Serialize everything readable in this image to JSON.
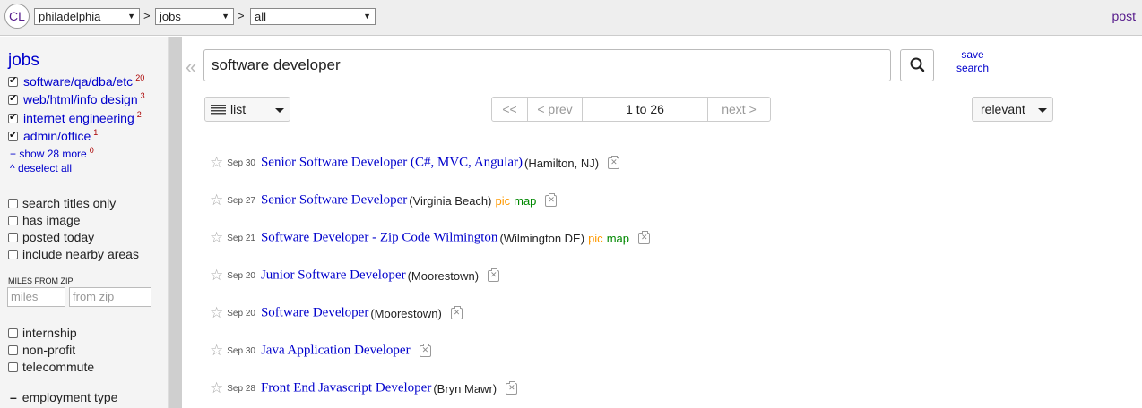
{
  "topbar": {
    "logo": "CL",
    "area": "philadelphia",
    "category": "jobs",
    "subcategory": "all",
    "separator": ">",
    "post_label": "post"
  },
  "sidebar": {
    "category_title": "jobs",
    "categories": [
      {
        "label": "software/qa/dba/etc",
        "count": "20",
        "checked": true
      },
      {
        "label": "web/html/info design",
        "count": "3",
        "checked": true
      },
      {
        "label": "internet engineering",
        "count": "2",
        "checked": true
      },
      {
        "label": "admin/office",
        "count": "1",
        "checked": true
      }
    ],
    "show_more": "+ show 28 more",
    "show_more_count": "0",
    "deselect_all": "^ deselect all",
    "options": [
      {
        "label": "search titles only"
      },
      {
        "label": "has image"
      },
      {
        "label": "posted today"
      },
      {
        "label": "include nearby areas"
      }
    ],
    "miles_label": "MILES FROM ZIP",
    "miles_placeholder": "miles",
    "zip_placeholder": "from zip",
    "options2": [
      {
        "label": "internship"
      },
      {
        "label": "non-profit"
      },
      {
        "label": "telecommute"
      }
    ],
    "employment_type": "employment type"
  },
  "search": {
    "collapse_glyph": "«",
    "query": "software developer",
    "save_label": "save search",
    "save_line1": "save",
    "save_line2": "search"
  },
  "controls": {
    "view_label": "list",
    "first": "<<",
    "prev": "< prev",
    "range": "1 to 26",
    "next": "next >",
    "sort_label": "relevant"
  },
  "results": [
    {
      "date": "Sep 30",
      "title": "Senior Software Developer (C#, MVC, Angular)",
      "location": "(Hamilton, NJ)",
      "pic": false,
      "map": false
    },
    {
      "date": "Sep 27",
      "title": "Senior Software Developer",
      "location": "(Virginia Beach)",
      "pic": true,
      "map": true
    },
    {
      "date": "Sep 21",
      "title": "Software Developer - Zip Code Wilmington",
      "location": "(Wilmington DE)",
      "pic": true,
      "map": true
    },
    {
      "date": "Sep 20",
      "title": "Junior Software Developer",
      "location": "(Moorestown)",
      "pic": false,
      "map": false
    },
    {
      "date": "Sep 20",
      "title": "Software Developer",
      "location": "(Moorestown)",
      "pic": false,
      "map": false
    },
    {
      "date": "Sep 30",
      "title": "Java Application Developer",
      "location": "",
      "pic": false,
      "map": false
    },
    {
      "date": "Sep 28",
      "title": "Front End Javascript Developer",
      "location": "(Bryn Mawr)",
      "pic": false,
      "map": false
    }
  ],
  "pic_label": "pic",
  "map_label": "map",
  "colors": {
    "link": "#0000cc",
    "visited": "#551a8b",
    "pic": "#ff9900",
    "map": "#008800"
  }
}
